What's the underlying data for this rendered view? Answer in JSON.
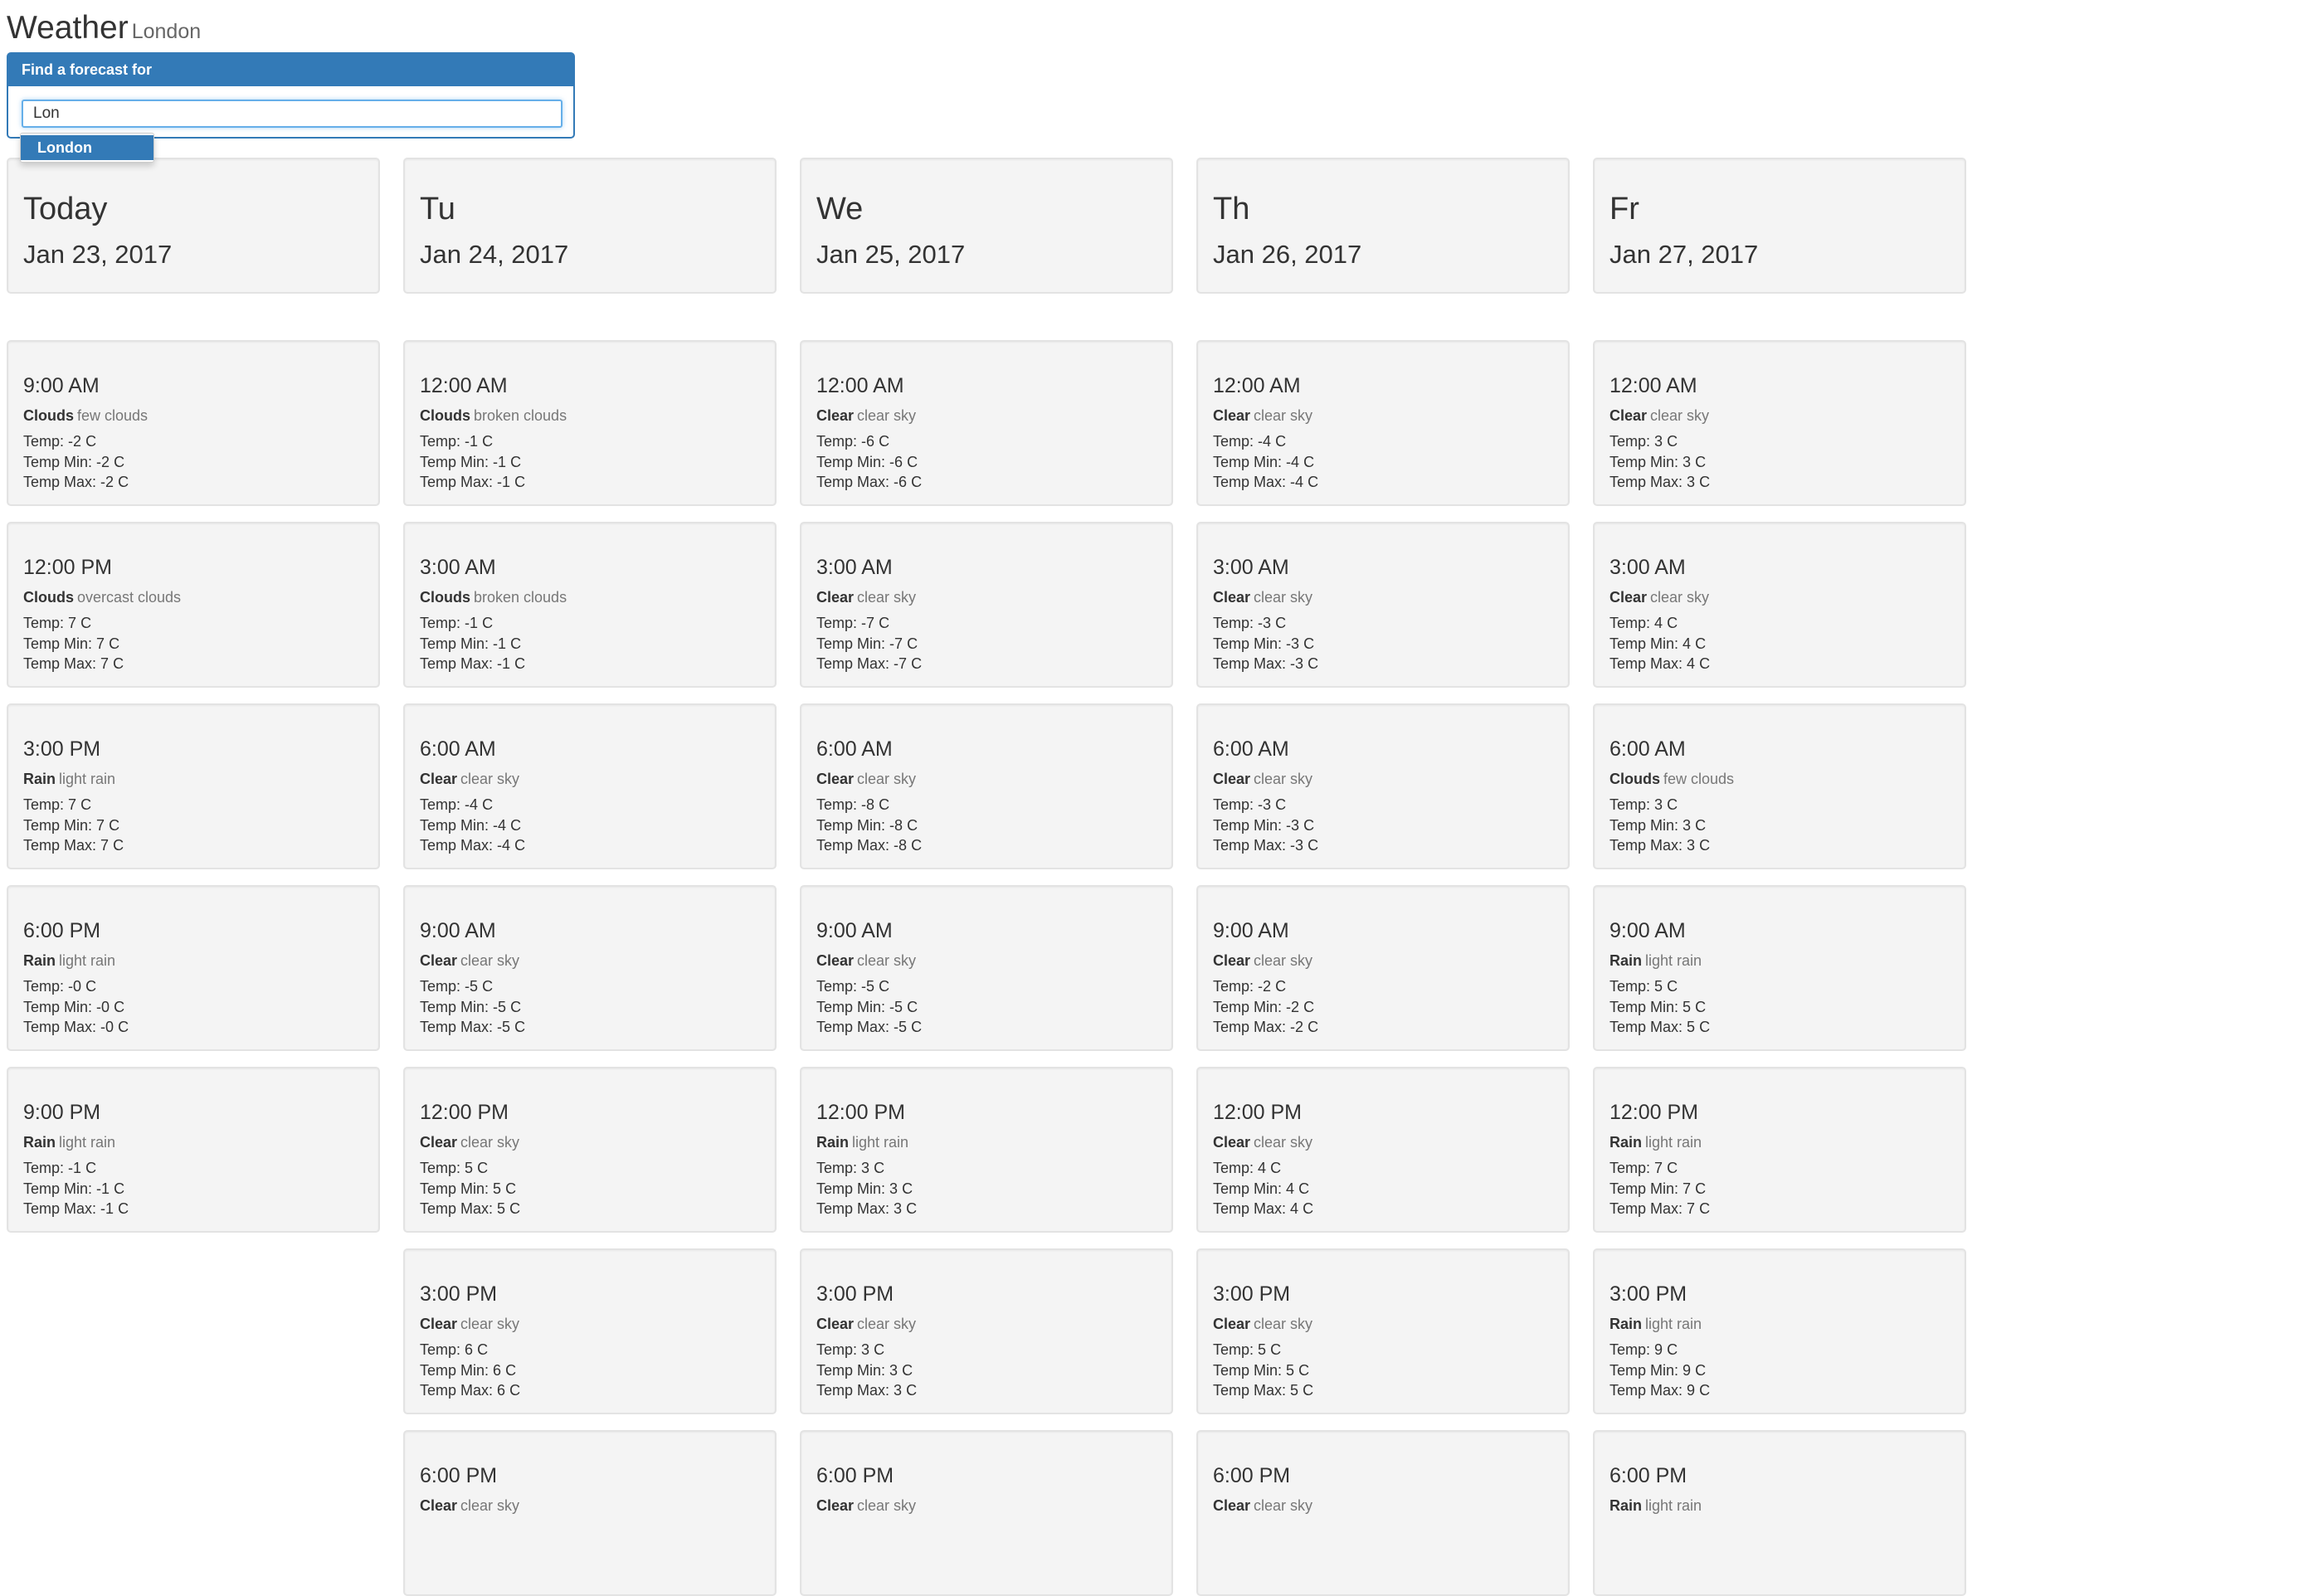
{
  "header": {
    "title": "Weather",
    "city": "London"
  },
  "search": {
    "panel_title": "Find a forecast for",
    "input_value": "Lon",
    "suggestions": [
      "London"
    ]
  },
  "labels": {
    "temp": "Temp:",
    "temp_min": "Temp Min:",
    "temp_max": "Temp Max:",
    "unit": "C"
  },
  "colors": {
    "primary": "#337ab7",
    "card_bg": "#f4f4f4",
    "card_border": "#e3e3e3"
  },
  "days": [
    {
      "name": "Today",
      "date": "Jan 23, 2017",
      "forecasts": [
        {
          "time": "9:00 AM",
          "main": "Clouds",
          "desc": "few clouds",
          "temp": "-2",
          "min": "-2",
          "max": "-2"
        },
        {
          "time": "12:00 PM",
          "main": "Clouds",
          "desc": "overcast clouds",
          "temp": "7",
          "min": "7",
          "max": "7"
        },
        {
          "time": "3:00 PM",
          "main": "Rain",
          "desc": "light rain",
          "temp": "7",
          "min": "7",
          "max": "7"
        },
        {
          "time": "6:00 PM",
          "main": "Rain",
          "desc": "light rain",
          "temp": "-0",
          "min": "-0",
          "max": "-0"
        },
        {
          "time": "9:00 PM",
          "main": "Rain",
          "desc": "light rain",
          "temp": "-1",
          "min": "-1",
          "max": "-1"
        }
      ]
    },
    {
      "name": "Tu",
      "date": "Jan 24, 2017",
      "forecasts": [
        {
          "time": "12:00 AM",
          "main": "Clouds",
          "desc": "broken clouds",
          "temp": "-1",
          "min": "-1",
          "max": "-1"
        },
        {
          "time": "3:00 AM",
          "main": "Clouds",
          "desc": "broken clouds",
          "temp": "-1",
          "min": "-1",
          "max": "-1"
        },
        {
          "time": "6:00 AM",
          "main": "Clear",
          "desc": "clear sky",
          "temp": "-4",
          "min": "-4",
          "max": "-4"
        },
        {
          "time": "9:00 AM",
          "main": "Clear",
          "desc": "clear sky",
          "temp": "-5",
          "min": "-5",
          "max": "-5"
        },
        {
          "time": "12:00 PM",
          "main": "Clear",
          "desc": "clear sky",
          "temp": "5",
          "min": "5",
          "max": "5"
        },
        {
          "time": "3:00 PM",
          "main": "Clear",
          "desc": "clear sky",
          "temp": "6",
          "min": "6",
          "max": "6"
        },
        {
          "time": "6:00 PM",
          "main": "Clear",
          "desc": "clear sky"
        }
      ]
    },
    {
      "name": "We",
      "date": "Jan 25, 2017",
      "forecasts": [
        {
          "time": "12:00 AM",
          "main": "Clear",
          "desc": "clear sky",
          "temp": "-6",
          "min": "-6",
          "max": "-6"
        },
        {
          "time": "3:00 AM",
          "main": "Clear",
          "desc": "clear sky",
          "temp": "-7",
          "min": "-7",
          "max": "-7"
        },
        {
          "time": "6:00 AM",
          "main": "Clear",
          "desc": "clear sky",
          "temp": "-8",
          "min": "-8",
          "max": "-8"
        },
        {
          "time": "9:00 AM",
          "main": "Clear",
          "desc": "clear sky",
          "temp": "-5",
          "min": "-5",
          "max": "-5"
        },
        {
          "time": "12:00 PM",
          "main": "Rain",
          "desc": "light rain",
          "temp": "3",
          "min": "3",
          "max": "3"
        },
        {
          "time": "3:00 PM",
          "main": "Clear",
          "desc": "clear sky",
          "temp": "3",
          "min": "3",
          "max": "3"
        },
        {
          "time": "6:00 PM",
          "main": "Clear",
          "desc": "clear sky"
        }
      ]
    },
    {
      "name": "Th",
      "date": "Jan 26, 2017",
      "forecasts": [
        {
          "time": "12:00 AM",
          "main": "Clear",
          "desc": "clear sky",
          "temp": "-4",
          "min": "-4",
          "max": "-4"
        },
        {
          "time": "3:00 AM",
          "main": "Clear",
          "desc": "clear sky",
          "temp": "-3",
          "min": "-3",
          "max": "-3"
        },
        {
          "time": "6:00 AM",
          "main": "Clear",
          "desc": "clear sky",
          "temp": "-3",
          "min": "-3",
          "max": "-3"
        },
        {
          "time": "9:00 AM",
          "main": "Clear",
          "desc": "clear sky",
          "temp": "-2",
          "min": "-2",
          "max": "-2"
        },
        {
          "time": "12:00 PM",
          "main": "Clear",
          "desc": "clear sky",
          "temp": "4",
          "min": "4",
          "max": "4"
        },
        {
          "time": "3:00 PM",
          "main": "Clear",
          "desc": "clear sky",
          "temp": "5",
          "min": "5",
          "max": "5"
        },
        {
          "time": "6:00 PM",
          "main": "Clear",
          "desc": "clear sky"
        }
      ]
    },
    {
      "name": "Fr",
      "date": "Jan 27, 2017",
      "forecasts": [
        {
          "time": "12:00 AM",
          "main": "Clear",
          "desc": "clear sky",
          "temp": "3",
          "min": "3",
          "max": "3"
        },
        {
          "time": "3:00 AM",
          "main": "Clear",
          "desc": "clear sky",
          "temp": "4",
          "min": "4",
          "max": "4"
        },
        {
          "time": "6:00 AM",
          "main": "Clouds",
          "desc": "few clouds",
          "temp": "3",
          "min": "3",
          "max": "3"
        },
        {
          "time": "9:00 AM",
          "main": "Rain",
          "desc": "light rain",
          "temp": "5",
          "min": "5",
          "max": "5"
        },
        {
          "time": "12:00 PM",
          "main": "Rain",
          "desc": "light rain",
          "temp": "7",
          "min": "7",
          "max": "7"
        },
        {
          "time": "3:00 PM",
          "main": "Rain",
          "desc": "light rain",
          "temp": "9",
          "min": "9",
          "max": "9"
        },
        {
          "time": "6:00 PM",
          "main": "Rain",
          "desc": "light rain"
        }
      ]
    }
  ]
}
